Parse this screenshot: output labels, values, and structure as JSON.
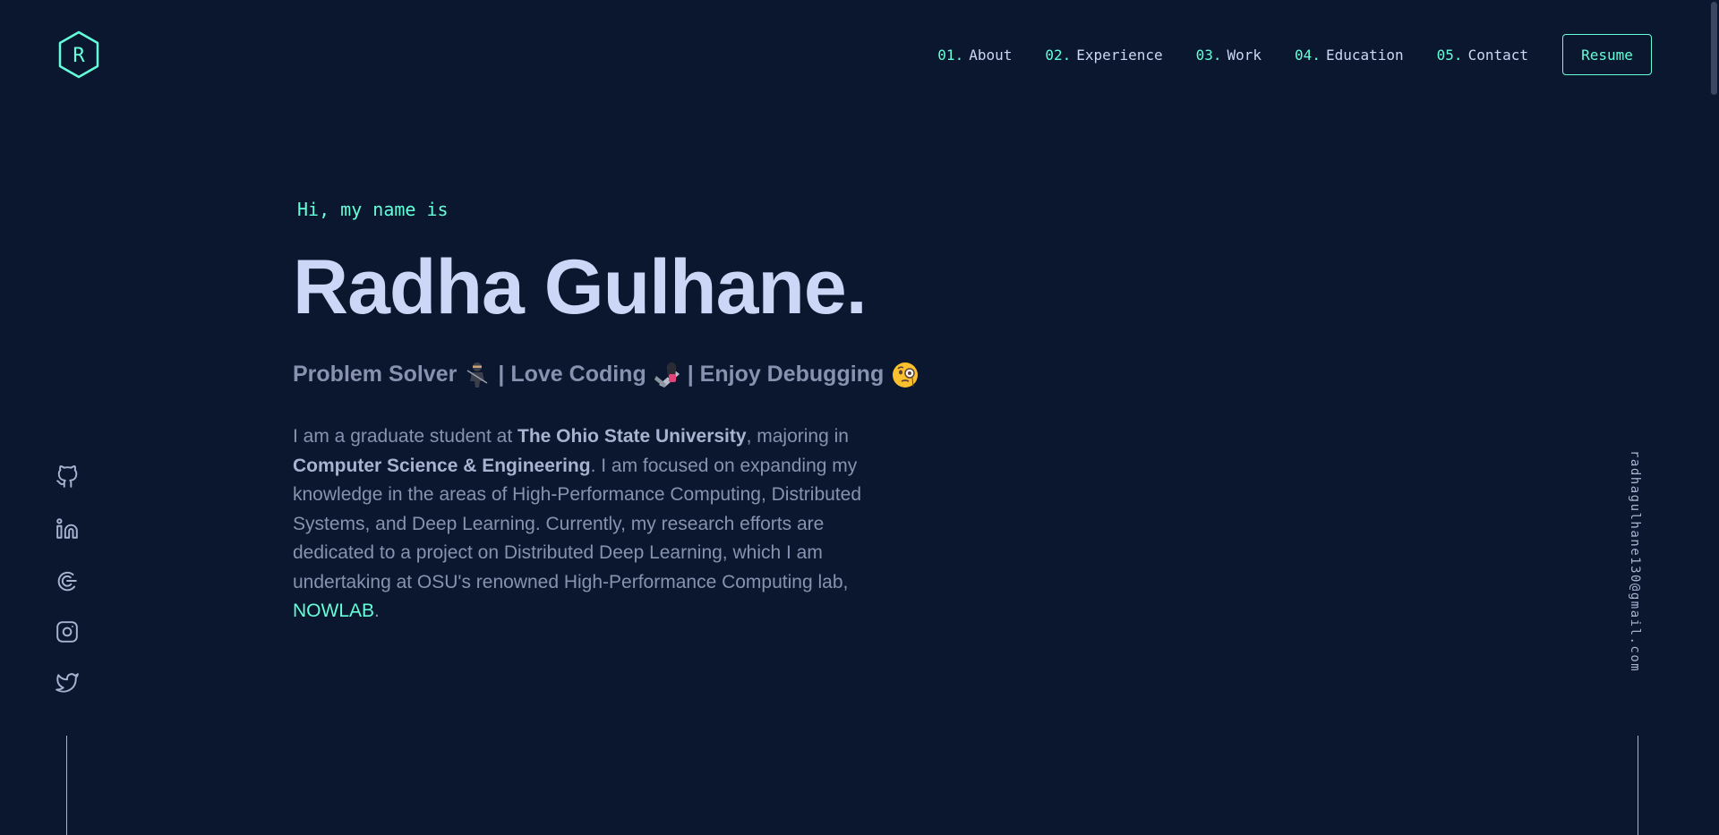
{
  "header": {
    "logo_letter": "R",
    "nav": [
      {
        "num": "01.",
        "label": "About"
      },
      {
        "num": "02.",
        "label": "Experience"
      },
      {
        "num": "03.",
        "label": "Work"
      },
      {
        "num": "04.",
        "label": "Education"
      },
      {
        "num": "05.",
        "label": "Contact"
      }
    ],
    "resume_label": "Resume"
  },
  "hero": {
    "greeting": "Hi, my name is",
    "name": "Radha Gulhane.",
    "tagline": {
      "part1": "Problem Solver",
      "part2": "| Love Coding",
      "part3": "| Enjoy Debugging",
      "emoji1": "ninja-emoji",
      "emoji2": "coder-emoji",
      "emoji3": "monocle-face-emoji"
    },
    "bio": {
      "t1": "I am a graduate student at ",
      "b1": "The Ohio State University",
      "t2": ", majoring in ",
      "b2": "Computer Science & Engineering",
      "t3": ". I am focused on expanding my knowledge in the areas of High-Performance Computing, Distributed Systems, and Deep Learning. Currently, my research efforts are dedicated to a project on Distributed Deep Learning, which I am undertaking at OSU's renowned High-Performance Computing lab, ",
      "link": "NOWLAB",
      "t4": "."
    }
  },
  "social": [
    {
      "name": "github-icon"
    },
    {
      "name": "linkedin-icon"
    },
    {
      "name": "codechef-icon"
    },
    {
      "name": "instagram-icon"
    },
    {
      "name": "twitter-icon"
    }
  ],
  "email": "radhagulhane130@gmail.com",
  "colors": {
    "background": "#0b172e",
    "accent": "#64ffda",
    "heading": "#ccd6f6",
    "text": "#8892b0"
  }
}
